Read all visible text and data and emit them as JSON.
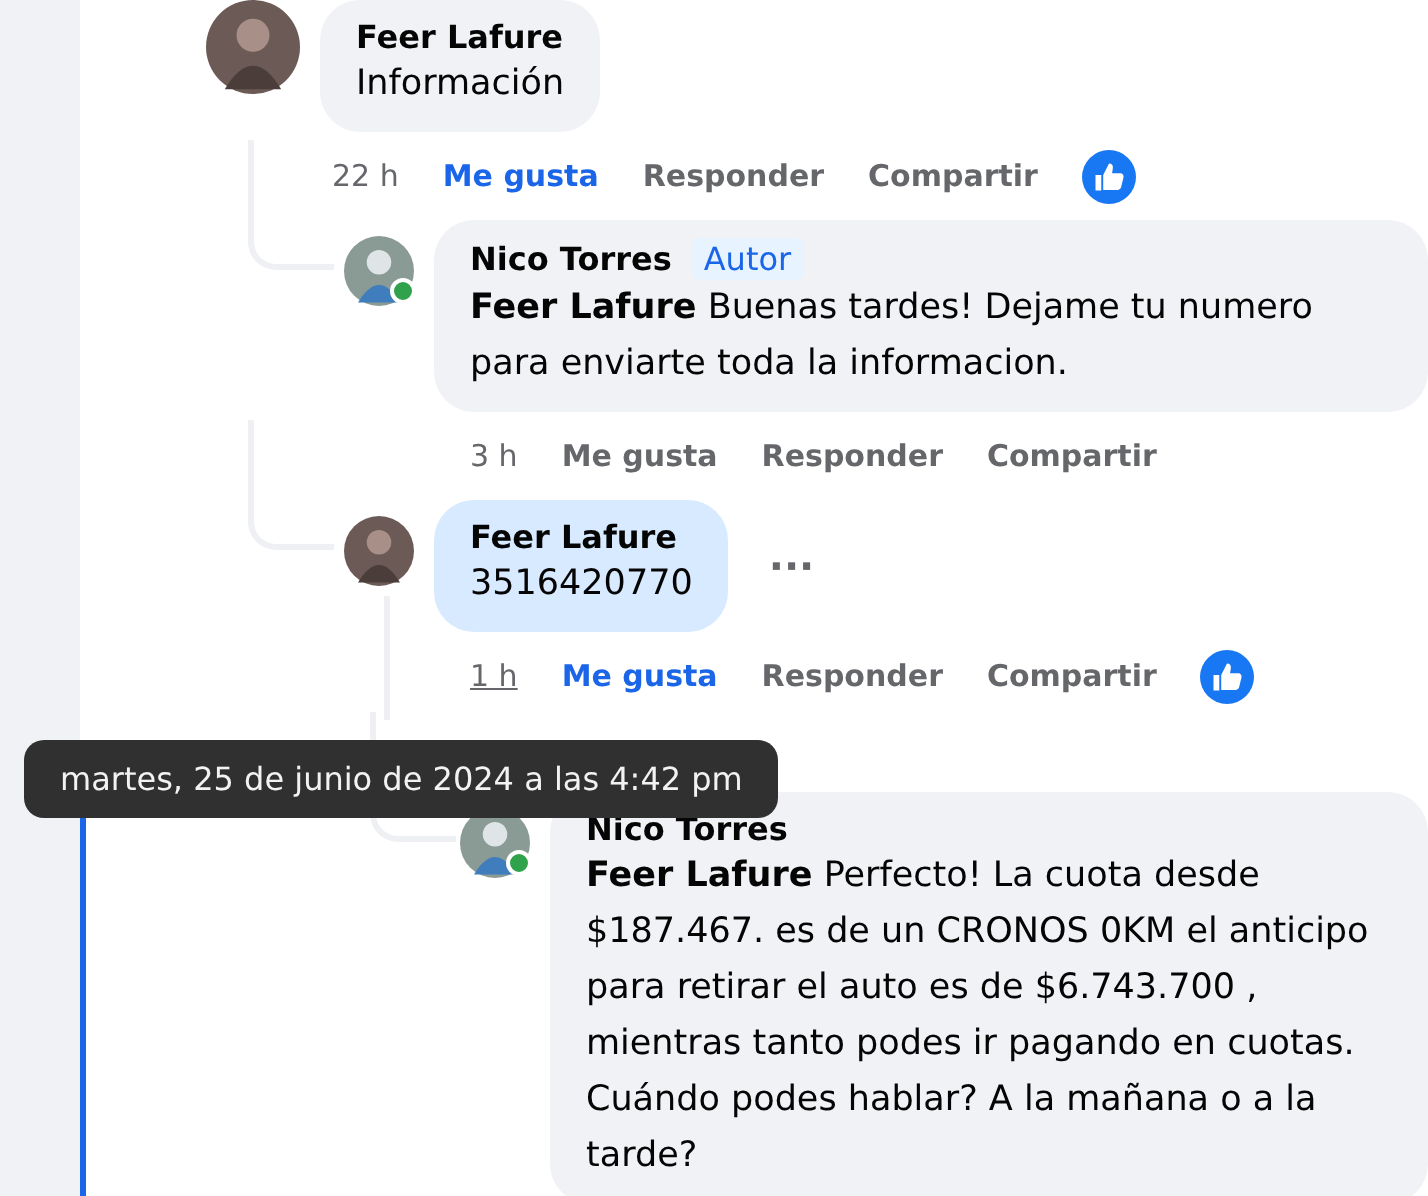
{
  "comments": [
    {
      "author": "Feer Lafure",
      "text": "Información",
      "time": "22 h",
      "time_hovered": false,
      "liked": true,
      "reaction": true,
      "highlighted": false,
      "online": false,
      "actions": [
        "Me gusta",
        "Responder",
        "Compartir"
      ],
      "children": [
        {
          "author": "Nico Torres",
          "badge": "Autor",
          "text": "**Feer Lafure** Buenas tardes! Dejame tu numero para enviarte toda la informacion.",
          "time": "3 h",
          "time_hovered": false,
          "liked": false,
          "reaction": false,
          "highlighted": false,
          "online": true,
          "actions": [
            "Me gusta",
            "Responder",
            "Compartir"
          ]
        },
        {
          "author": "Feer Lafure",
          "text": "3516420770",
          "more": "···",
          "time": "1 h",
          "time_hovered": true,
          "liked": true,
          "reaction": true,
          "highlighted": true,
          "online": false,
          "actions": [
            "Me gusta",
            "Responder",
            "Compartir"
          ],
          "children": [
            {
              "author": "Nico Torres",
              "text": "**Feer Lafure** Perfecto! La cuota desde $187.467. es de un CRONOS 0KM el anticipo para retirar el auto es de $6.743.700 , mientras tanto podes ir pagando en cuotas. Cuándo podes hablar? A la mañana o a la tarde?",
              "online": true,
              "highlighted": false
            }
          ]
        }
      ]
    }
  ],
  "tooltip": "martes, 25 de junio de 2024 a las 4:42 pm"
}
